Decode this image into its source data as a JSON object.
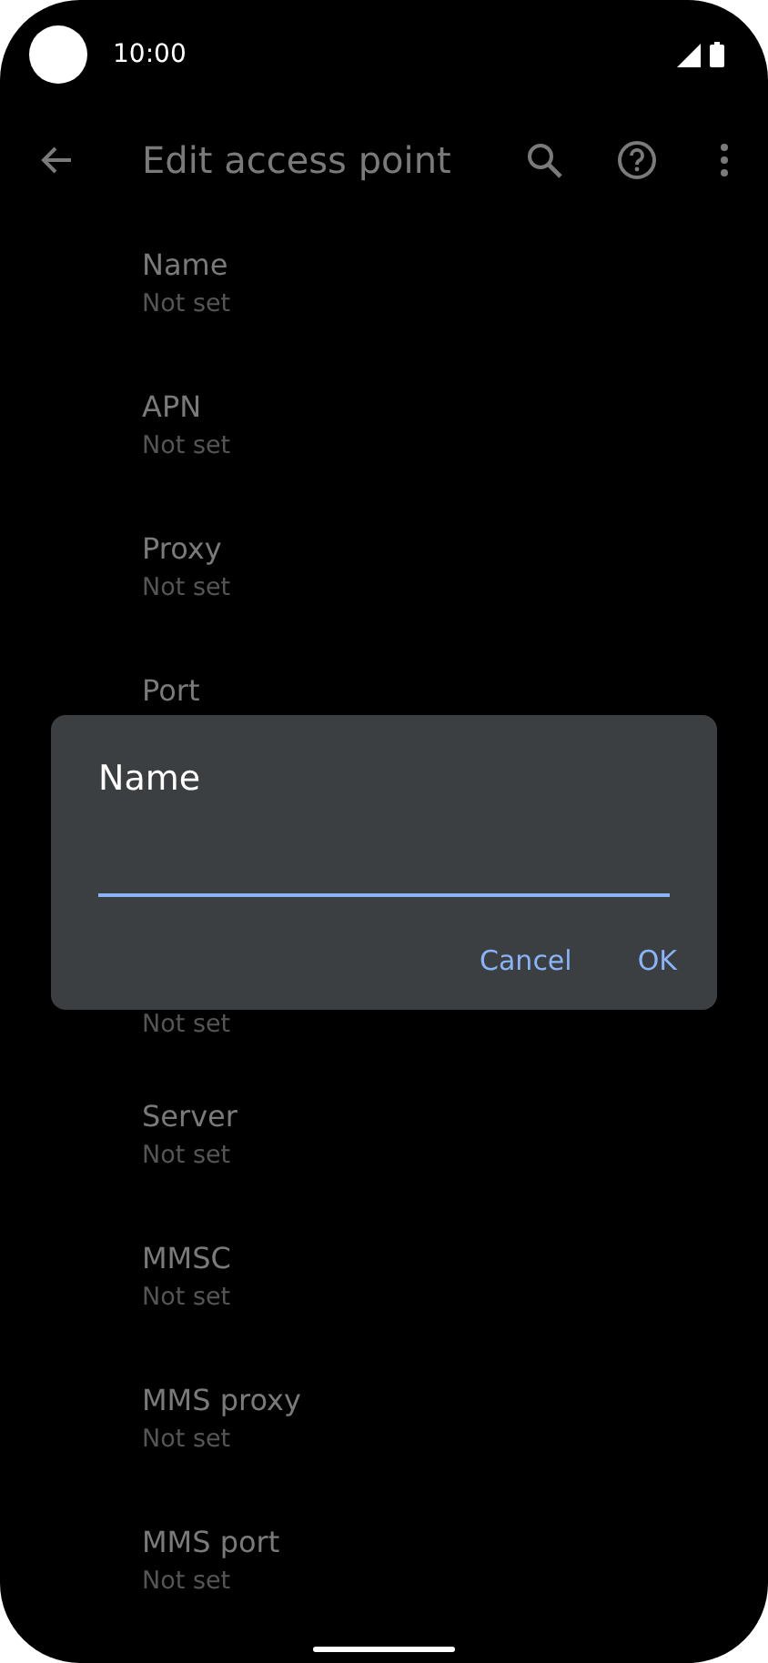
{
  "status_bar": {
    "time": "10:00"
  },
  "toolbar": {
    "title": "Edit access point"
  },
  "settings": [
    {
      "title": "Name",
      "summary": "Not set"
    },
    {
      "title": "APN",
      "summary": "Not set"
    },
    {
      "title": "Proxy",
      "summary": "Not set"
    },
    {
      "title": "Port"
    },
    {
      "summary": "Not set"
    },
    {
      "title": "Server",
      "summary": "Not set"
    },
    {
      "title": "MMSC",
      "summary": "Not set"
    },
    {
      "title": "MMS proxy",
      "summary": "Not set"
    },
    {
      "title": "MMS port",
      "summary": "Not set"
    }
  ],
  "dialog": {
    "title": "Name",
    "buttons": [
      "Cancel",
      "OK"
    ]
  }
}
